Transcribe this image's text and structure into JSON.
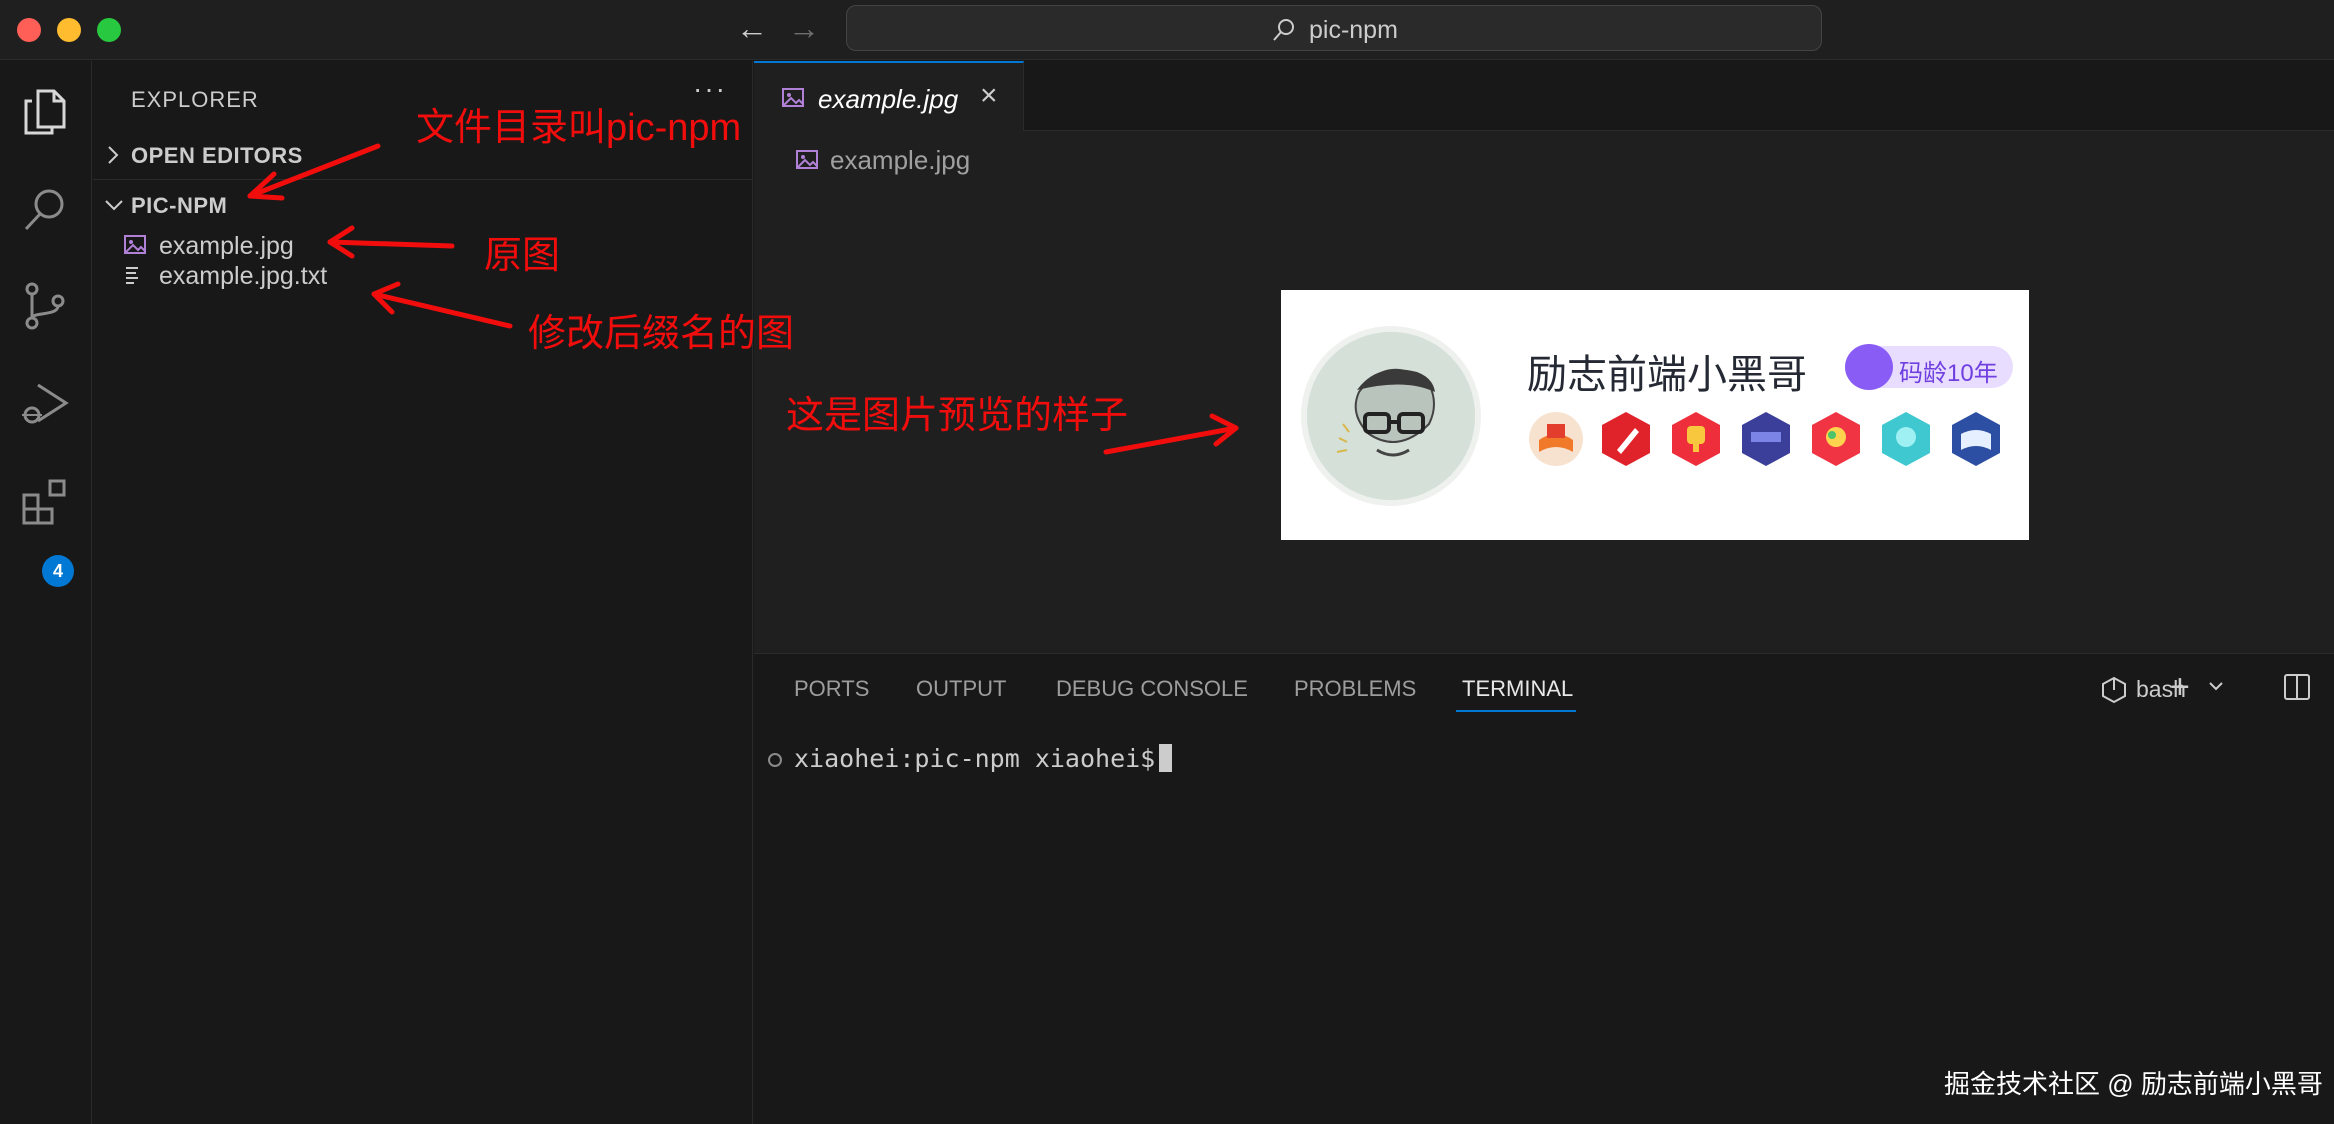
{
  "window": {
    "search_text": "pic-npm"
  },
  "activity_bar": {
    "extensions_badge": "4"
  },
  "sidebar": {
    "title": "EXPLORER",
    "more": "···",
    "sections": {
      "open_editors": "OPEN EDITORS",
      "project": "PIC-NPM"
    },
    "files": [
      {
        "name": "example.jpg",
        "type": "image"
      },
      {
        "name": "example.jpg.txt",
        "type": "text"
      }
    ]
  },
  "annotations": {
    "folder_note": "文件目录叫pic-npm",
    "original_note": "原图",
    "renamed_note": "修改后缀名的图",
    "preview_note": "这是图片预览的样子"
  },
  "editor": {
    "tab_label": "example.jpg",
    "tab_close": "×",
    "breadcrumb": "example.jpg"
  },
  "preview_image": {
    "name": "励志前端小黑哥",
    "badge": "码龄10年"
  },
  "panel": {
    "tabs": [
      "PORTS",
      "OUTPUT",
      "DEBUG CONSOLE",
      "PROBLEMS",
      "TERMINAL"
    ],
    "active_tab": "TERMINAL",
    "shell": "bash",
    "add": "+",
    "prompt": "xiaohei:pic-npm xiaohei$"
  },
  "watermark": "掘金技术社区 @ 励志前端小黑哥",
  "colors": {
    "accent": "#0078d4",
    "annotation": "#f20d0d",
    "background": "#181818"
  }
}
